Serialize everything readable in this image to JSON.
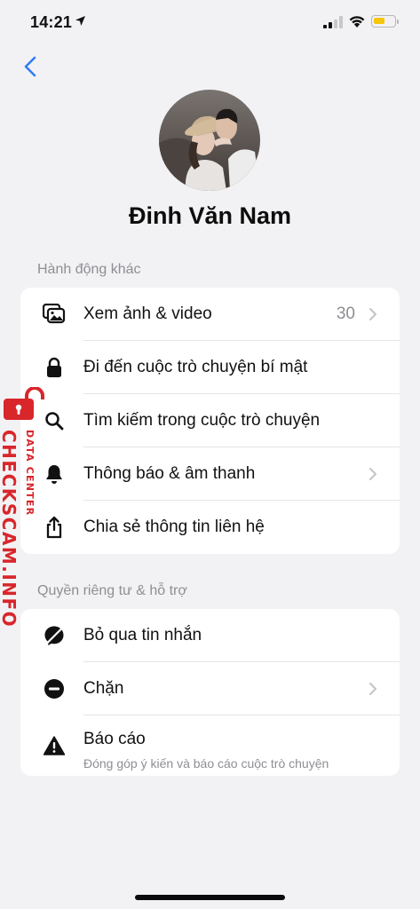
{
  "status_bar": {
    "time": "14:21",
    "battery_level": 0.55
  },
  "profile": {
    "name": "Đinh Văn Nam"
  },
  "sections": [
    {
      "header": "Hành động khác",
      "items": [
        {
          "label": "Xem ảnh & video",
          "count": "30",
          "icon": "photos-icon"
        },
        {
          "label": "Đi đến cuộc trò chuyện bí mật",
          "icon": "lock-icon"
        },
        {
          "label": "Tìm kiếm trong cuộc trò chuyện",
          "icon": "search-icon"
        },
        {
          "label": "Thông báo & âm thanh",
          "icon": "bell-icon"
        },
        {
          "label": "Chia sẻ thông tin liên hệ",
          "icon": "share-icon"
        }
      ]
    },
    {
      "header": "Quyền riêng tư & hỗ trợ",
      "items": [
        {
          "label": "Bỏ qua tin nhắn",
          "icon": "ignore-icon"
        },
        {
          "label": "Chặn",
          "icon": "block-icon"
        },
        {
          "label": "Báo cáo",
          "subtitle": "Đóng góp ý kiến và báo cáo cuộc trò chuyện",
          "icon": "warning-icon"
        }
      ]
    }
  ],
  "watermark": {
    "main": "CHECKSCAM.INFO",
    "sub": "DATA CENTER"
  },
  "colors": {
    "accent": "#2f7df6",
    "watermark": "#d8262b",
    "background": "#f2f2f4"
  }
}
